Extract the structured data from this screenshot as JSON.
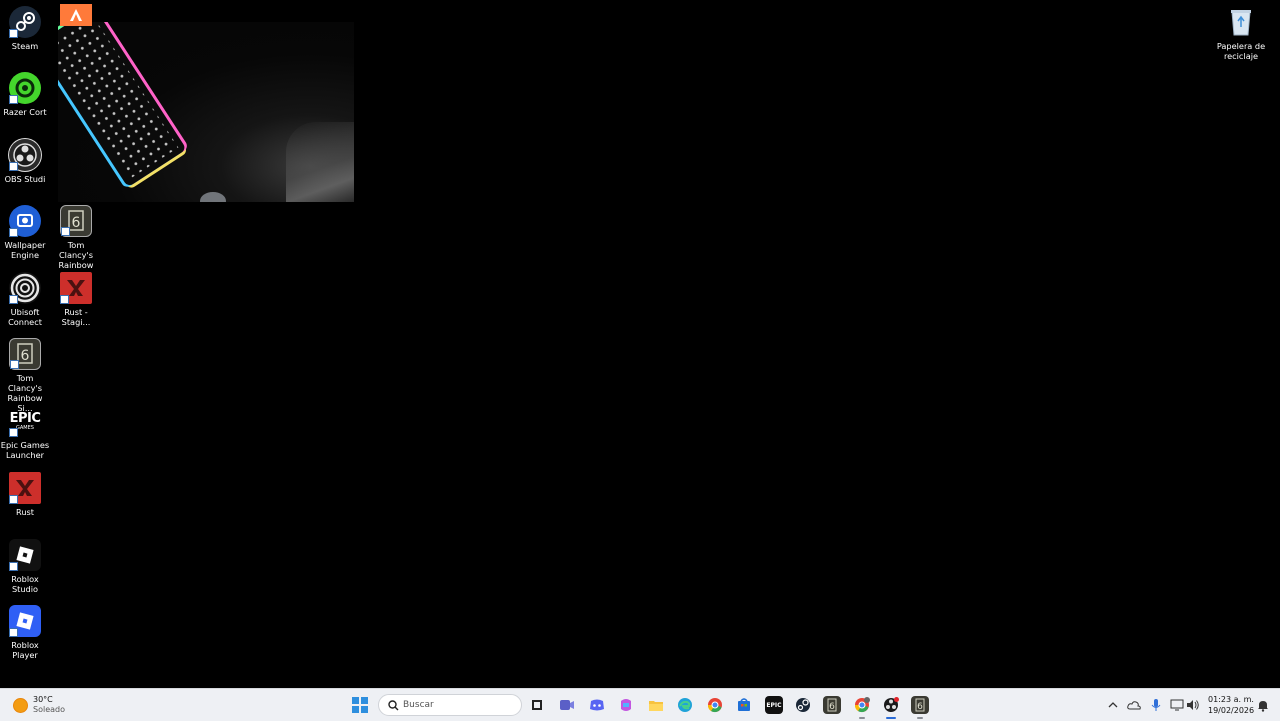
{
  "desktop": {
    "icons": [
      {
        "label": "Steam",
        "icon": "steam-icon"
      },
      {
        "label": "Razer Cort",
        "icon": "razer-cortex-icon"
      },
      {
        "label": "OBS Studi",
        "icon": "obs-studio-icon"
      },
      {
        "label": "Wallpaper\nEngine",
        "icon": "wallpaper-engine-icon"
      },
      {
        "label": "Ubisoft\nConnect",
        "icon": "ubisoft-connect-icon"
      },
      {
        "label": "Tom Clancy's\nRainbow Si...",
        "icon": "rainbow-six-icon"
      },
      {
        "label": "Epic Games\nLauncher",
        "icon": "epic-games-icon"
      },
      {
        "label": "Rust",
        "icon": "rust-icon"
      },
      {
        "label": "Roblox\nStudio",
        "icon": "roblox-studio-icon"
      },
      {
        "label": "Roblox Player",
        "icon": "roblox-player-icon"
      },
      {
        "label": "Tom Clancy's\nRainbow Si...",
        "icon": "rainbow-six-icon"
      },
      {
        "label": "Rust -\nStagi...",
        "icon": "rust-staging-icon"
      },
      {
        "label": "Papelera de\nreciclaje",
        "icon": "recycle-bin-icon"
      }
    ],
    "epic_logo_text": "EPIC",
    "epic_logo_sub": "GAMES"
  },
  "taskbar": {
    "weather": {
      "temp": "30°C",
      "condition": "Soleado",
      "icon": "sun-icon"
    },
    "search_placeholder": "Buscar",
    "pinned": [
      "task-view-icon",
      "teams-meet-icon",
      "discord-icon",
      "copilot-icon",
      "file-explorer-icon",
      "edge-icon",
      "chrome-icon",
      "store-icon",
      "epic-games-icon",
      "steam-icon",
      "rainbow-six-icon",
      "chrome-profile-icon",
      "obs-studio-icon",
      "rainbow-six-icon"
    ],
    "tray": {
      "icons": [
        "chevron-up-icon",
        "onedrive-icon",
        "microphone-icon",
        "network-icon",
        "volume-icon"
      ]
    },
    "clock": {
      "time": "01:23 a. m.",
      "date": "19/02/2026"
    },
    "notification_icon": "bell-icon"
  },
  "colors": {
    "taskbar_bg": "#eef0f4",
    "accent": "#2a6bd6",
    "desktop_bg": "#000000"
  }
}
